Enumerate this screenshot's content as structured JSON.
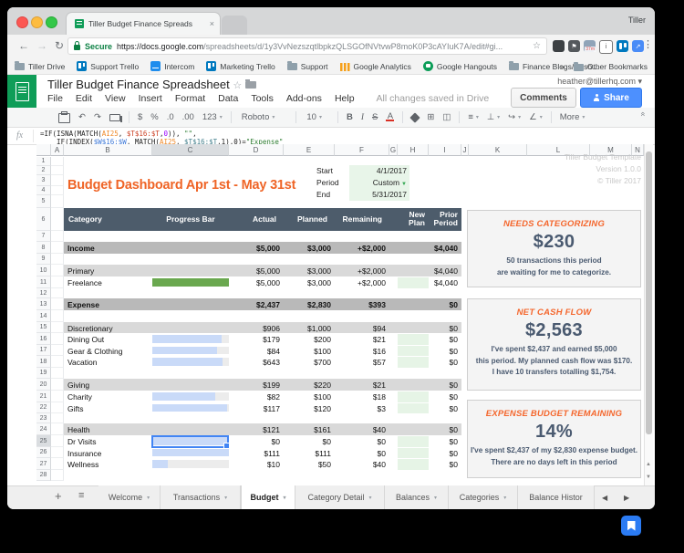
{
  "colors": {
    "accent_orange": "#ef6426",
    "header_band": "#4d5c6b",
    "slate_text": "#4a5a70",
    "green_bar": "#6aa84f",
    "blue_bar": "#c9daf8",
    "light_green_cell": "#e6f4e6",
    "share_blue": "#4d90fe",
    "sheets_green": "#0f9d58",
    "selection_blue": "#4285f4"
  },
  "browser": {
    "profile": "Tiller",
    "tab": {
      "title": "Tiller Budget Finance Spreads",
      "close": "×"
    },
    "nav": {
      "back": "←",
      "forward": "→",
      "reload": "↻",
      "secure_label": "Secure",
      "url_host": "https://docs.google.com",
      "url_path": "/spreadsheets/d/1y3VvNezszqtlbpkzQLSGOfNVtvwP8moK0P3cAYIuK7A/edit#gi...",
      "star": "☆",
      "menu": "⋮"
    },
    "extensions": [
      {
        "name": "dark-extension-icon",
        "bg": "#3c4043",
        "glyph": ""
      },
      {
        "name": "flag-extension-icon",
        "bg": "#54585c",
        "glyph": "⚑"
      },
      {
        "name": "time-tracker-extension-icon",
        "bg": "#90a4b8",
        "glyph": "",
        "badge": "37m"
      },
      {
        "name": "info-extension-icon",
        "bg": "#ffffff",
        "glyph": "i",
        "border": "#767676",
        "fg": "#555555"
      },
      {
        "name": "trello-extension-icon",
        "bg": "#0079bf",
        "glyph": "",
        "trello": true
      },
      {
        "name": "chart-extension-icon",
        "bg": "#4a8cf7",
        "glyph": "↗"
      }
    ],
    "bookmarks": [
      {
        "label": "Tiller Drive",
        "type": "folder"
      },
      {
        "label": "Support Trello",
        "type": "trello"
      },
      {
        "label": "Intercom",
        "type": "intercom"
      },
      {
        "label": "Marketing Trello",
        "type": "trello"
      },
      {
        "label": "Support",
        "type": "folder"
      },
      {
        "label": "Google Analytics",
        "type": "analytics"
      },
      {
        "label": "Google Hangouts",
        "type": "hangouts"
      },
      {
        "label": "Finance Blogs/Reso...",
        "type": "folder"
      }
    ],
    "bookmarks_overflow": "»",
    "other_bookmarks": {
      "label": "Other Bookmarks",
      "type": "folder"
    }
  },
  "sheets": {
    "doc_title": "Tiller Budget Finance Spreadsheet",
    "title_star": "☆",
    "menus": [
      "File",
      "Edit",
      "View",
      "Insert",
      "Format",
      "Data",
      "Tools",
      "Add-ons",
      "Help"
    ],
    "save_status": "All changes saved in Drive",
    "account": "heather@tillerhq.com ▾",
    "comments_label": "Comments",
    "share_label": "Share",
    "toolbar_items": [
      {
        "name": "print-icon",
        "icon": "print"
      },
      {
        "name": "undo-icon",
        "glyph": "↶"
      },
      {
        "name": "redo-icon",
        "glyph": "↷"
      },
      {
        "name": "paint-format-icon",
        "icon": "paint"
      },
      {
        "name": "divider"
      },
      {
        "name": "currency-format-button",
        "glyph": "$"
      },
      {
        "name": "percent-format-button",
        "glyph": "%"
      },
      {
        "name": "decrease-decimal-button",
        "glyph": ".0"
      },
      {
        "name": "increase-decimal-button",
        "glyph": ".00"
      },
      {
        "name": "number-format-button",
        "glyph": "123",
        "caret": true
      },
      {
        "name": "divider"
      },
      {
        "name": "font-family-select",
        "glyph": "Roboto",
        "caret": true,
        "pad": 14
      },
      {
        "name": "divider"
      },
      {
        "name": "font-size-select",
        "glyph": "10",
        "caret": true,
        "pad": 8
      },
      {
        "name": "divider"
      },
      {
        "name": "bold-button",
        "glyph": "B",
        "cls": "b"
      },
      {
        "name": "italic-button",
        "glyph": "I",
        "cls": "i"
      },
      {
        "name": "strikethrough-button",
        "glyph": "S",
        "cls": "s"
      },
      {
        "name": "text-color-button",
        "glyph": "A",
        "underbar": true
      },
      {
        "name": "divider"
      },
      {
        "name": "fill-color-icon",
        "icon": "fill"
      },
      {
        "name": "borders-icon",
        "glyph": "⊞"
      },
      {
        "name": "merge-cells-icon",
        "glyph": "◫"
      },
      {
        "name": "divider"
      },
      {
        "name": "horizontal-align-icon",
        "glyph": "≡",
        "caret": true
      },
      {
        "name": "vertical-align-icon",
        "glyph": "⊥",
        "caret": true
      },
      {
        "name": "text-wrap-icon",
        "glyph": "↪",
        "caret": true
      },
      {
        "name": "text-rotate-icon",
        "glyph": "∠",
        "caret": true
      },
      {
        "name": "divider"
      },
      {
        "name": "more-button",
        "glyph": "More",
        "caret": true
      }
    ],
    "toolbar_collapse": "«",
    "formula_bar": {
      "fx": "fx",
      "line1": [
        {
          "t": "=IF(ISNA(MATCH(",
          "c": "#222222"
        },
        {
          "t": "AI25",
          "c": "#ef8a2a"
        },
        {
          "t": ", ",
          "c": "#222222"
        },
        {
          "t": "$T$16:$T",
          "c": "#cc4125"
        },
        {
          "t": ",",
          "c": "#222222"
        },
        {
          "t": "0",
          "c": "#9900ff"
        },
        {
          "t": ")), ",
          "c": "#222222"
        },
        {
          "t": "\"\"",
          "c": "#2e7d32"
        },
        {
          "t": ",",
          "c": "#222222"
        }
      ],
      "line2": [
        {
          "t": "    IF(INDEX(",
          "c": "#222222"
        },
        {
          "t": "$W$16:$W",
          "c": "#3c78d8"
        },
        {
          "t": ", MATCH(",
          "c": "#222222"
        },
        {
          "t": "AI25",
          "c": "#ef8a2a"
        },
        {
          "t": ", ",
          "c": "#222222"
        },
        {
          "t": "$T$16:$T",
          "c": "#45818e"
        },
        {
          "t": ",1),0)=",
          "c": "#222222"
        },
        {
          "t": "\"Expense\"",
          "c": "#2e7d32"
        }
      ]
    },
    "grid": {
      "columns": [
        "A",
        "B",
        "C",
        "D",
        "E",
        "F",
        "G",
        "H",
        "I",
        "J",
        "K",
        "L",
        "M",
        "N"
      ],
      "row_count": 28,
      "selected_column": "C",
      "selected_row": 25,
      "col_scroll_hint": "◂"
    }
  },
  "dashboard": {
    "title": "Budget Dashboard Apr 1st - May 31st",
    "period": {
      "start_label": "Start",
      "start": "4/1/2017",
      "period_label": "Period",
      "period": "Custom",
      "end_label": "End",
      "end": "5/31/2017"
    },
    "template_info": [
      "Tiller Budget Template",
      "Version 1.0.0",
      "© Tiller 2017"
    ],
    "table": {
      "headers": [
        "Category",
        "Progress Bar",
        "Actual",
        "Planned",
        "Remaining",
        "New Plan",
        "Prior Period"
      ],
      "rows": [
        {
          "r": 8,
          "kind": "total",
          "label": "Income",
          "actual": "$5,000",
          "planned": "$3,000",
          "remaining": "+$2,000",
          "prior": "$4,040"
        },
        {
          "r": 10,
          "kind": "group",
          "label": "Primary",
          "actual": "$5,000",
          "planned": "$3,000",
          "remaining": "+$2,000",
          "prior": "$4,040"
        },
        {
          "r": 11,
          "kind": "leaf",
          "label": "Freelance",
          "bar_color": "#6aa84f",
          "bar_pct": 100,
          "actual": "$5,000",
          "planned": "$3,000",
          "remaining": "+$2,000",
          "new_plan_cell": true,
          "prior": "$4,040"
        },
        {
          "r": 13,
          "kind": "total",
          "label": "Expense",
          "actual": "$2,437",
          "planned": "$2,830",
          "remaining": "$393",
          "prior": "$0"
        },
        {
          "r": 15,
          "kind": "group",
          "label": "Discretionary",
          "actual": "$906",
          "planned": "$1,000",
          "remaining": "$94",
          "prior": "$0"
        },
        {
          "r": 16,
          "kind": "leaf",
          "label": "Dining Out",
          "bar_color": "#c9daf8",
          "bar_pct": 90,
          "actual": "$179",
          "planned": "$200",
          "remaining": "$21",
          "new_plan_cell": true,
          "prior": "$0"
        },
        {
          "r": 17,
          "kind": "leaf",
          "label": "Gear & Clothing",
          "bar_color": "#c9daf8",
          "bar_pct": 84,
          "actual": "$84",
          "planned": "$100",
          "remaining": "$16",
          "new_plan_cell": true,
          "prior": "$0"
        },
        {
          "r": 18,
          "kind": "leaf",
          "label": "Vacation",
          "bar_color": "#c9daf8",
          "bar_pct": 92,
          "actual": "$643",
          "planned": "$700",
          "remaining": "$57",
          "new_plan_cell": true,
          "prior": "$0"
        },
        {
          "r": 20,
          "kind": "group",
          "label": "Giving",
          "actual": "$199",
          "planned": "$220",
          "remaining": "$21",
          "prior": "$0"
        },
        {
          "r": 21,
          "kind": "leaf",
          "label": "Charity",
          "bar_color": "#c9daf8",
          "bar_pct": 82,
          "actual": "$82",
          "planned": "$100",
          "remaining": "$18",
          "new_plan_cell": true,
          "prior": "$0"
        },
        {
          "r": 22,
          "kind": "leaf",
          "label": "Gifts",
          "bar_color": "#c9daf8",
          "bar_pct": 98,
          "actual": "$117",
          "planned": "$120",
          "remaining": "$3",
          "new_plan_cell": true,
          "prior": "$0"
        },
        {
          "r": 24,
          "kind": "group",
          "label": "Health",
          "actual": "$121",
          "planned": "$161",
          "remaining": "$40",
          "prior": "$0"
        },
        {
          "r": 25,
          "kind": "leaf",
          "label": "Dr Visits",
          "bar_color": "#c9daf8",
          "bar_pct": 100,
          "selected": true,
          "actual": "$0",
          "planned": "$0",
          "remaining": "$0",
          "new_plan_cell": true,
          "prior": "$0"
        },
        {
          "r": 26,
          "kind": "leaf",
          "label": "Insurance",
          "bar_color": "#c9daf8",
          "bar_pct": 100,
          "actual": "$111",
          "planned": "$111",
          "remaining": "$0",
          "new_plan_cell": true,
          "prior": "$0"
        },
        {
          "r": 27,
          "kind": "leaf",
          "label": "Wellness",
          "bar_color": "#c9daf8",
          "bar_pct": 20,
          "actual": "$10",
          "planned": "$50",
          "remaining": "$40",
          "new_plan_cell": true,
          "prior": "$0"
        }
      ]
    },
    "cards": [
      {
        "title": "NEEDS CATEGORIZING",
        "value": "$230",
        "lines": [
          "50 transactions this period",
          "are waiting for me to categorize."
        ]
      },
      {
        "title": "NET CASH FLOW",
        "value": "$2,563",
        "lines": [
          "I've spent $2,437 and earned $5,000",
          "this period. My planned cash flow was $170.",
          "I have 10 transfers totalling $1,754."
        ]
      },
      {
        "title": "EXPENSE BUDGET REMAINING",
        "value": "14%",
        "lines": [
          "I've spent $2,437 of my $2,830 expense budget.",
          "There are no days left in this period"
        ]
      }
    ]
  },
  "sheet_tabs": {
    "add": "+",
    "all_sheets": "≡",
    "tabs": [
      "Welcome",
      "Transactions",
      "Budget",
      "Category Detail",
      "Balances",
      "Categories",
      "Balance Histor"
    ],
    "active": "Budget",
    "scroll_left": "◀",
    "scroll_right": "▶"
  }
}
